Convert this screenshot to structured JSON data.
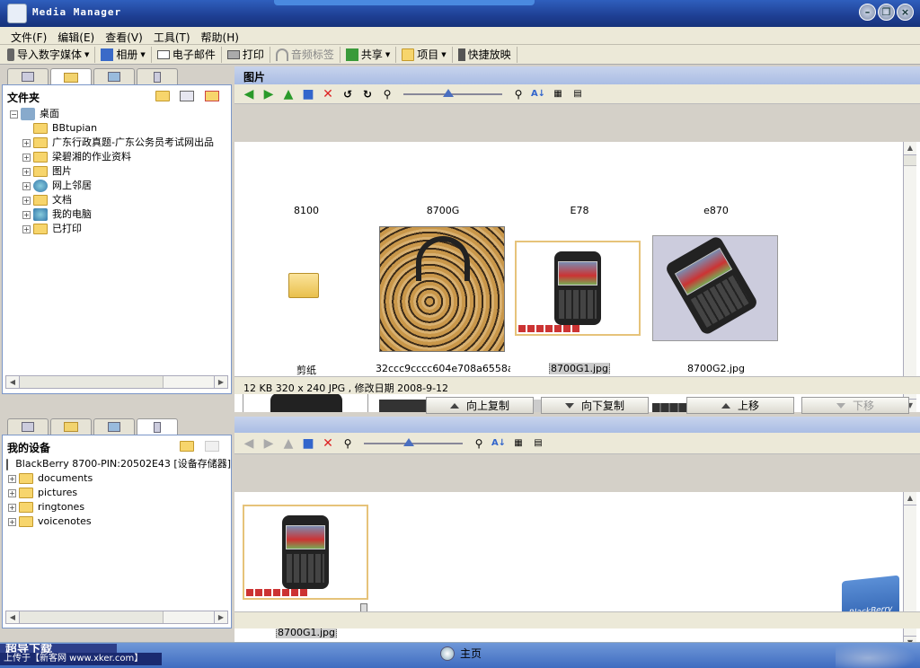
{
  "window": {
    "title": "Media Manager"
  },
  "menu": [
    "文件(F)",
    "编辑(E)",
    "查看(V)",
    "工具(T)",
    "帮助(H)"
  ],
  "toolbar": {
    "import": "导入数字媒体",
    "album": "相册",
    "email": "电子邮件",
    "print": "打印",
    "audio_tag": "音频标签",
    "share": "共享",
    "project": "项目",
    "slideshow": "快捷放映"
  },
  "folders_pane": {
    "header": "文件夹",
    "tree": {
      "root": "桌面",
      "items": [
        "BBtupian",
        "广东行政真题-广东公务员考试网出品",
        "梁碧湘的作业资料",
        "图片",
        "网上邻居",
        "文档",
        "我的电脑",
        "已打印"
      ]
    }
  },
  "pictures_pane": {
    "header": "图片",
    "top_captions": [
      "8100",
      "8700G",
      "E78",
      "e870"
    ],
    "items": [
      {
        "caption": "剪纸",
        "kind": "folder"
      },
      {
        "caption": "32ccc9cccc604e708a6558a…",
        "kind": "photo-leopard"
      },
      {
        "caption": "8700G1.jpg",
        "kind": "photo-phone",
        "selected": true
      },
      {
        "caption": "8700G2.jpg",
        "kind": "photo-phone-angle"
      }
    ],
    "status": "12 KB  320 x 240 JPG  , 修改日期 2008-9-12"
  },
  "copy_buttons": {
    "copy_up": "向上复制",
    "copy_down": "向下复制",
    "move_up": "上移",
    "move_down": "下移"
  },
  "device_pane": {
    "header": "我的设备",
    "device": "BlackBerry 8700-PIN:20502E43 [设备存储器]",
    "items": [
      "documents",
      "pictures",
      "ringtones",
      "voicenotes"
    ]
  },
  "device_files": {
    "items": [
      {
        "caption": "8700G1.jpg"
      }
    ],
    "brand": "BlackBerry"
  },
  "bottom": {
    "home": "主页",
    "left_text": "超导下载",
    "watermark": "上传于【新客网 www.xker.com】"
  },
  "colors": {
    "accent": "#3f6cc0",
    "title": "#1e3f93",
    "selection": "#e6c37a"
  }
}
